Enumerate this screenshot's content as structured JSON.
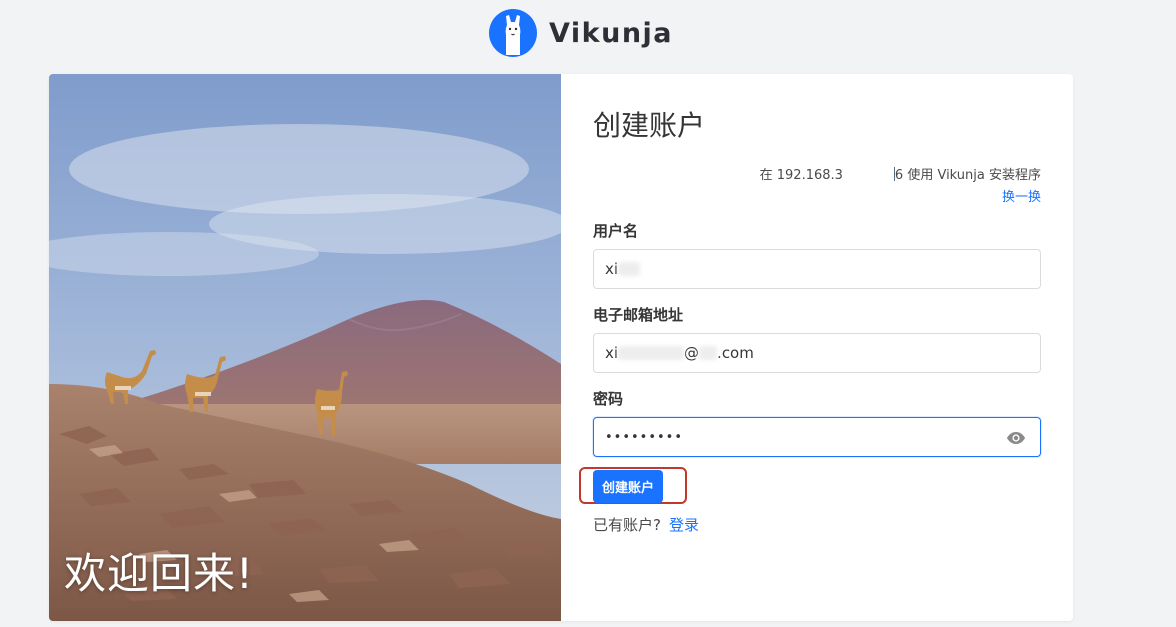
{
  "app": {
    "name": "Vikunja"
  },
  "hero": {
    "welcome_text": "欢迎回来!"
  },
  "register": {
    "title": "创建账户",
    "server_prefix": "在 192.168.3",
    "server_suffix": "6 使用 Vikunja 安装程序",
    "change_server_link": "换一换",
    "username_label": "用户名",
    "username_value": "xi",
    "email_label": "电子邮箱地址",
    "email_value_start": "xi",
    "email_value_end": "@",
    "email_value_tail": ".com",
    "password_label": "密码",
    "password_value": "•••••••••",
    "submit_label": "创建账户",
    "have_account_text": "已有账户?",
    "login_link": "登录"
  },
  "colors": {
    "primary": "#1973ff",
    "background": "#f2f3f5",
    "highlight": "#c0392b"
  },
  "icons": {
    "logo": "llama-logo-icon",
    "password_toggle": "eye-icon"
  }
}
